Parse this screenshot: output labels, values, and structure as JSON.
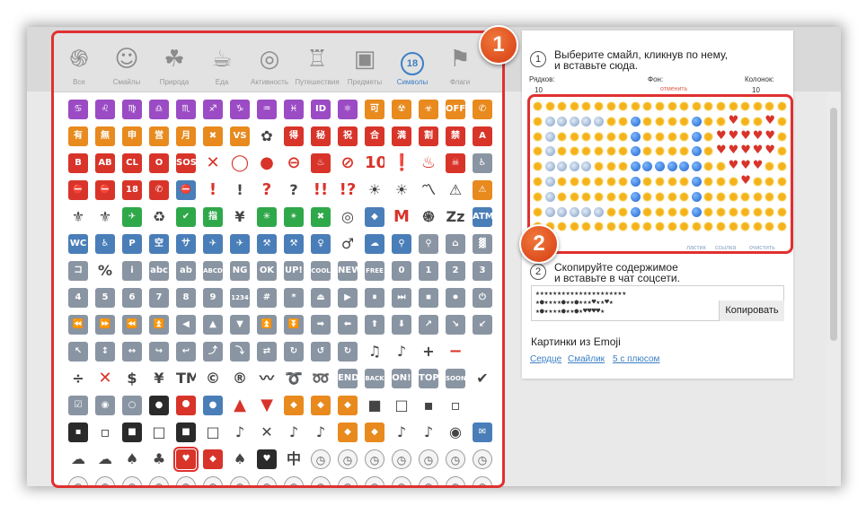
{
  "categories": [
    {
      "label": "Все",
      "icon": "spiral-icon",
      "glyph": "֍"
    },
    {
      "label": "Смайлы",
      "icon": "face-icon",
      "glyph": "☺"
    },
    {
      "label": "Природа",
      "icon": "monkey-icon",
      "glyph": "☘"
    },
    {
      "label": "Еда",
      "icon": "food-icon",
      "glyph": "☕"
    },
    {
      "label": "Активность",
      "icon": "target-icon",
      "glyph": "◎"
    },
    {
      "label": "Путешествия",
      "icon": "building-icon",
      "glyph": "♖"
    },
    {
      "label": "Предметы",
      "icon": "computer-icon",
      "glyph": "▣"
    },
    {
      "label": "Символы",
      "icon": "eighteen-icon",
      "glyph": "18"
    },
    {
      "label": "Флаги",
      "icon": "flag-icon",
      "glyph": "⚑"
    }
  ],
  "emoji_rows": [
    [
      [
        "♋",
        "purple"
      ],
      [
        "♌",
        "purple"
      ],
      [
        "♍",
        "purple"
      ],
      [
        "♎",
        "purple"
      ],
      [
        "♏",
        "purple"
      ],
      [
        "♐",
        "purple"
      ],
      [
        "♑",
        "purple"
      ],
      [
        "♒",
        "purple"
      ],
      [
        "♓",
        "purple"
      ],
      [
        "ID",
        "purple"
      ],
      [
        "⚛",
        "purple"
      ],
      [
        "可",
        "orange"
      ],
      [
        "☢",
        "orange"
      ],
      [
        "☣",
        "orange"
      ],
      [
        "OFF",
        "orange"
      ],
      [
        "✆",
        "orange"
      ]
    ],
    [
      [
        "有",
        "orange"
      ],
      [
        "無",
        "orange"
      ],
      [
        "申",
        "orange"
      ],
      [
        "営",
        "orange"
      ],
      [
        "月",
        "orange"
      ],
      [
        "✖",
        "orange"
      ],
      [
        "VS",
        "orange"
      ],
      [
        "✿",
        "plain"
      ],
      [
        "得",
        "red"
      ],
      [
        "秘",
        "red"
      ],
      [
        "祝",
        "red"
      ],
      [
        "合",
        "red"
      ],
      [
        "満",
        "red"
      ],
      [
        "割",
        "red"
      ],
      [
        "禁",
        "red"
      ],
      [
        "A",
        "red"
      ]
    ],
    [
      [
        "B",
        "red"
      ],
      [
        "AB",
        "red"
      ],
      [
        "CL",
        "red"
      ],
      [
        "O",
        "red"
      ],
      [
        "SOS",
        "red"
      ],
      [
        "✕",
        "plainred"
      ],
      [
        "◯",
        "plainred"
      ],
      [
        "●",
        "plainred"
      ],
      [
        "⊖",
        "plainred"
      ],
      [
        "♨",
        "red"
      ],
      [
        "⊘",
        "plainred"
      ],
      [
        "100",
        "plainred"
      ],
      [
        "❗",
        "plainred"
      ],
      [
        "♨",
        "plainred"
      ],
      [
        "☠",
        "red"
      ],
      [
        "♿",
        "gray"
      ]
    ],
    [
      [
        "⛔",
        "red"
      ],
      [
        "⛔",
        "red"
      ],
      [
        "18",
        "red"
      ],
      [
        "✆",
        "red"
      ],
      [
        "⛔",
        "blue"
      ],
      [
        "!",
        "plainred"
      ],
      [
        "!",
        "plain"
      ],
      [
        "?",
        "plainred"
      ],
      [
        "?",
        "plain"
      ],
      [
        "!!",
        "plainred"
      ],
      [
        "!?",
        "plainred"
      ],
      [
        "☀",
        "plain"
      ],
      [
        "☀",
        "plain"
      ],
      [
        "〽",
        "plain"
      ],
      [
        "⚠",
        "plain"
      ],
      [
        "⚠",
        "orange"
      ]
    ],
    [
      [
        "⚜",
        "plain"
      ],
      [
        "⚜",
        "plain"
      ],
      [
        "✈",
        "green"
      ],
      [
        "♻",
        "plain"
      ],
      [
        "✔",
        "green"
      ],
      [
        "指",
        "green"
      ],
      [
        "¥",
        "plain"
      ],
      [
        "✳",
        "green"
      ],
      [
        "✴",
        "green"
      ],
      [
        "✖",
        "green"
      ],
      [
        "◎",
        "plain"
      ],
      [
        "◆",
        "blue"
      ],
      [
        "M",
        "plainred"
      ],
      [
        "֍",
        "plain"
      ],
      [
        "Zz",
        "plain"
      ],
      [
        "ATM",
        "blue"
      ]
    ],
    [
      [
        "WC",
        "blue"
      ],
      [
        "♿",
        "blue"
      ],
      [
        "P",
        "blue"
      ],
      [
        "空",
        "blue"
      ],
      [
        "サ",
        "blue"
      ],
      [
        "✈",
        "blue"
      ],
      [
        "✈",
        "blue"
      ],
      [
        "⚒",
        "blue"
      ],
      [
        "⚒",
        "blue"
      ],
      [
        "♀",
        "blue"
      ],
      [
        "♂",
        "plain"
      ],
      [
        "☁",
        "blue"
      ],
      [
        "⚲",
        "blue"
      ],
      [
        "⚲",
        "gray"
      ],
      [
        "⌂",
        "gray"
      ],
      [
        "▓",
        "gray"
      ]
    ],
    [
      [
        "コ",
        "gray"
      ],
      [
        "%",
        "plain"
      ],
      [
        "i",
        "gray"
      ],
      [
        "abc",
        "gray"
      ],
      [
        "ab",
        "gray"
      ],
      [
        "ABCD",
        "gray"
      ],
      [
        "NG",
        "gray"
      ],
      [
        "OK",
        "gray"
      ],
      [
        "UP!",
        "gray"
      ],
      [
        "COOL",
        "gray"
      ],
      [
        "NEW",
        "gray"
      ],
      [
        "FREE",
        "gray"
      ],
      [
        "0",
        "gray"
      ],
      [
        "1",
        "gray"
      ],
      [
        "2",
        "gray"
      ],
      [
        "3",
        "gray"
      ]
    ],
    [
      [
        "4",
        "gray"
      ],
      [
        "5",
        "gray"
      ],
      [
        "6",
        "gray"
      ],
      [
        "7",
        "gray"
      ],
      [
        "8",
        "gray"
      ],
      [
        "9",
        "gray"
      ],
      [
        "1234",
        "gray"
      ],
      [
        "#",
        "gray"
      ],
      [
        "*",
        "gray"
      ],
      [
        "⏏",
        "gray"
      ],
      [
        "▶",
        "gray"
      ],
      [
        "⏸",
        "gray"
      ],
      [
        "⏭",
        "gray"
      ],
      [
        "⏹",
        "gray"
      ],
      [
        "⏺",
        "gray"
      ],
      [
        "⏻",
        "gray"
      ]
    ],
    [
      [
        "⏪",
        "gray"
      ],
      [
        "⏩",
        "gray"
      ],
      [
        "⏪",
        "gray"
      ],
      [
        "⏫",
        "gray"
      ],
      [
        "◀",
        "gray"
      ],
      [
        "▲",
        "gray"
      ],
      [
        "▼",
        "gray"
      ],
      [
        "⏫",
        "gray"
      ],
      [
        "⏬",
        "gray"
      ],
      [
        "➡",
        "gray"
      ],
      [
        "⬅",
        "gray"
      ],
      [
        "⬆",
        "gray"
      ],
      [
        "⬇",
        "gray"
      ],
      [
        "↗",
        "gray"
      ],
      [
        "↘",
        "gray"
      ],
      [
        "↙",
        "gray"
      ]
    ],
    [
      [
        "↖",
        "gray"
      ],
      [
        "↕",
        "gray"
      ],
      [
        "↔",
        "gray"
      ],
      [
        "↪",
        "gray"
      ],
      [
        "↩",
        "gray"
      ],
      [
        "⤴",
        "gray"
      ],
      [
        "⤵",
        "gray"
      ],
      [
        "⇄",
        "gray"
      ],
      [
        "↻",
        "gray"
      ],
      [
        "↺",
        "gray"
      ],
      [
        "↻",
        "gray"
      ],
      [
        "♫",
        "plain"
      ],
      [
        "♪",
        "plain"
      ],
      [
        "+",
        "plain"
      ],
      [
        "−",
        "plainred"
      ],
      [
        "",
        ""
      ]
    ],
    [
      [
        "÷",
        "plain"
      ],
      [
        "✕",
        "plainred"
      ],
      [
        "$",
        "plain"
      ],
      [
        "¥",
        "plain"
      ],
      [
        "TM",
        "plain"
      ],
      [
        "©",
        "plain"
      ],
      [
        "®",
        "plain"
      ],
      [
        "〰",
        "plain"
      ],
      [
        "➰",
        "plain"
      ],
      [
        "➿",
        "plain"
      ],
      [
        "END",
        "gray"
      ],
      [
        "BACK",
        "gray"
      ],
      [
        "ON!",
        "gray"
      ],
      [
        "TOP",
        "gray"
      ],
      [
        "SOON",
        "gray"
      ],
      [
        "✔",
        "plain"
      ]
    ],
    [
      [
        "☑",
        "gray"
      ],
      [
        "◉",
        "gray"
      ],
      [
        "○",
        "gray"
      ],
      [
        "●",
        "black"
      ],
      [
        "⯃",
        "red"
      ],
      [
        "●",
        "blue"
      ],
      [
        "▲",
        "plainred"
      ],
      [
        "▼",
        "plainred"
      ],
      [
        "◆",
        "orange"
      ],
      [
        "◆",
        "orange"
      ],
      [
        "◆",
        "orange"
      ],
      [
        "■",
        "plain"
      ],
      [
        "□",
        "plain"
      ],
      [
        "▪",
        "plain"
      ],
      [
        "▫",
        "plain"
      ],
      [
        "",
        ""
      ]
    ],
    [
      [
        "▪",
        "black"
      ],
      [
        "▫",
        "plain"
      ],
      [
        "■",
        "black"
      ],
      [
        "□",
        "plain"
      ],
      [
        "■",
        "black"
      ],
      [
        "□",
        "plain"
      ],
      [
        "♪",
        "plain"
      ],
      [
        "✕",
        "plain"
      ],
      [
        "♪",
        "plain"
      ],
      [
        "♪",
        "plain"
      ],
      [
        "◆",
        "orange"
      ],
      [
        "◆",
        "orange"
      ],
      [
        "♪",
        "plain"
      ],
      [
        "♪",
        "plain"
      ],
      [
        "◉",
        "plain"
      ],
      [
        "✉",
        "blue"
      ]
    ],
    [
      [
        "☁",
        "plain"
      ],
      [
        "☁",
        "plain"
      ],
      [
        "♠",
        "plain"
      ],
      [
        "♣",
        "plain"
      ],
      [
        "♥",
        "red"
      ],
      [
        "◆",
        "red"
      ],
      [
        "♠",
        "plain"
      ],
      [
        "♥",
        "black"
      ],
      [
        "中",
        "plain"
      ],
      [
        "◷",
        "clock"
      ],
      [
        "◷",
        "clock"
      ],
      [
        "◷",
        "clock"
      ],
      [
        "◷",
        "clock"
      ],
      [
        "◷",
        "clock"
      ],
      [
        "◷",
        "clock"
      ],
      [
        "◷",
        "clock"
      ]
    ],
    [
      [
        "◷",
        "clock"
      ],
      [
        "◷",
        "clock"
      ],
      [
        "◷",
        "clock"
      ],
      [
        "◷",
        "clock"
      ],
      [
        "◷",
        "clock"
      ],
      [
        "◷",
        "clock"
      ],
      [
        "◷",
        "clock"
      ],
      [
        "◷",
        "clock"
      ],
      [
        "◷",
        "clock"
      ],
      [
        "◷",
        "clock"
      ],
      [
        "◷",
        "clock"
      ],
      [
        "◷",
        "clock"
      ],
      [
        "◷",
        "clock"
      ],
      [
        "◷",
        "clock"
      ],
      [
        "◷",
        "clock"
      ],
      [
        "◷",
        "clock"
      ]
    ]
  ],
  "selected_emoji": {
    "row": 13,
    "col": 4
  },
  "badge1": "1",
  "badge2": "2",
  "step1": {
    "num": "1",
    "text_line1": "Выберите смайл, кликнув по нему,",
    "text_line2": "и вставьте сюда."
  },
  "controls": {
    "rows_label": "Рядков:",
    "rows_value": "10",
    "bg_label": "Фон:",
    "bg_link": "отменить",
    "cols_label": "Колонок:",
    "cols_value": "10"
  },
  "canvas": {
    "legend": {
      "S": "sun",
      "B": "ball",
      "G": "globe",
      "H": "heart"
    },
    "rows": [
      "SSSSSSSSSSSSSSSSSSSSS",
      "SGGGGGSSBSSSSBSSHSSHS",
      "SGSSSSSSBSSSSBSHHHHHS",
      "SGSSSSSSBSSSSBSHHHHHS",
      "SGGGGSSSBBBBBBSSHHHSS",
      "SGSSSSSSBSSSSBSSSHSSS",
      "SGSSSSSSBSSSSBSSSSSSS",
      "SGGGGGSSBSSSSBSSSSSSS",
      "SSSSSSSSSSSSSSSSSSSSS"
    ],
    "links": [
      "ластик",
      "ссылка",
      "очистить"
    ]
  },
  "step2": {
    "num": "2",
    "text_line1": "Скопируйте содержимое",
    "text_line2": "и вставьте в чат соцсети."
  },
  "copy_content": "★★★★★★★★★★★★★★★★★★★★★\n★●★★★★●★★●★★★♥★★♥★\n★●★★★★●★★●★♥♥♥♥★",
  "copy_button": "Копировать",
  "pictures": {
    "title": "Картинки из Emoji",
    "links": [
      "Сердце",
      "Смайлик",
      "5 с плюсом"
    ]
  }
}
